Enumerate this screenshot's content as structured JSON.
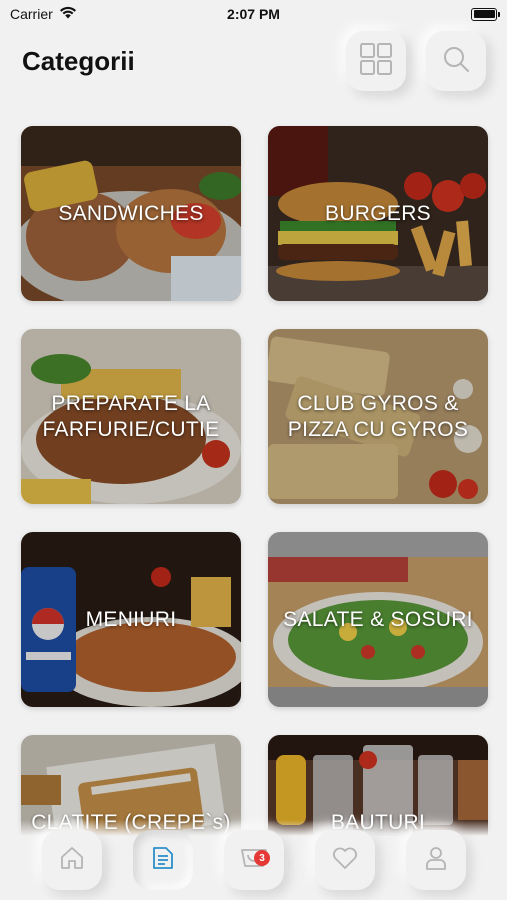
{
  "status_bar": {
    "carrier": "Carrier",
    "time": "2:07 PM",
    "wifi_icon": "wifi-icon",
    "battery_icon": "battery-icon"
  },
  "header": {
    "title": "Categorii",
    "grid_button_icon": "grid-icon",
    "search_button_icon": "search-icon"
  },
  "categories": [
    {
      "label": "SANDWICHES"
    },
    {
      "label": "BURGERS"
    },
    {
      "label": "PREPARATE LA\nFARFURIE/CUTIE"
    },
    {
      "label": "CLUB GYROS &\nPIZZA CU GYROS"
    },
    {
      "label": "MENIURI"
    },
    {
      "label": "SALATE & SOSURI"
    },
    {
      "label": "CLATITE (CREPE`s)"
    },
    {
      "label": "BAUTURI"
    }
  ],
  "tab_bar": {
    "items": [
      {
        "name": "home",
        "icon": "home-icon"
      },
      {
        "name": "menu",
        "icon": "document-icon",
        "active": true
      },
      {
        "name": "cart",
        "icon": "cart-icon",
        "badge": "3"
      },
      {
        "name": "favorites",
        "icon": "heart-icon"
      },
      {
        "name": "profile",
        "icon": "user-icon"
      }
    ]
  },
  "colors": {
    "background": "#f1f1f1",
    "accent": "#2c8fc9",
    "badge": "#e53935",
    "icon_gray": "#b5b5b5"
  }
}
